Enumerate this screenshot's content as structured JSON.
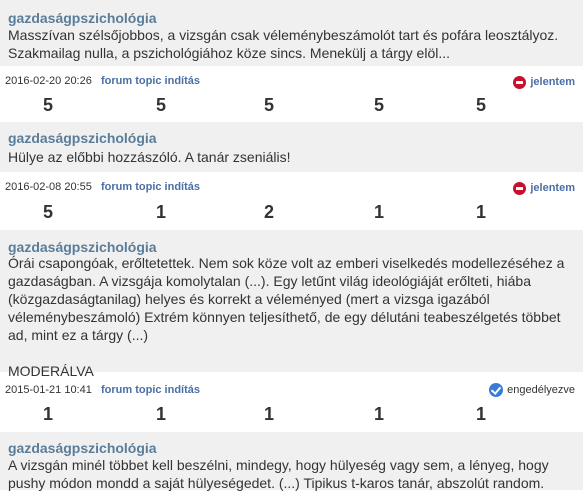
{
  "reviews": [
    {
      "subject": "gazdaságpszichológia",
      "text": "Masszívan szélsőjobbos, a vizsgán csak véleménybeszámolót tart és pofára leosztályoz. Szakmailag nulla, a pszichológiához köze sincs. Menekülj a tárgy elöl...",
      "date": "2016-02-20 20:26",
      "link": "forum topic indítás",
      "status": "jelentem",
      "status_icon": "stop-icon",
      "ratings": [
        "5",
        "5",
        "5",
        "5",
        "5"
      ]
    },
    {
      "subject": "gazdaságpszichológia",
      "text": "Hülye az előbbi hozzászóló. A tanár zseniális!",
      "date": "2016-02-08 20:55",
      "link": "forum topic indítás",
      "status": "jelentem",
      "status_icon": "stop-icon",
      "ratings": [
        "5",
        "1",
        "2",
        "1",
        "1"
      ]
    },
    {
      "subject": "gazdaságpszichológia",
      "text": "Órái csapongóak, erőltetettek. Nem sok köze volt az emberi viselkedés modellezéséhez a gazdaságban. A vizsgája komolytalan (...). Egy letűnt világ ideológiáját erőlteti, hiába (közgazdaságtanilag) helyes és korrekt a véleményed (mert a vizsga igazából véleménybeszámoló) Extrém könnyen teljesíthető, de egy délutáni teabeszélgetés többet ad, mint ez a tárgy (...)\n\nMODERÁLVA",
      "date": "2015-01-21 10:41",
      "link": "forum topic indítás",
      "status": "engedélyezve",
      "status_icon": "check-icon",
      "ratings": [
        "1",
        "1",
        "1",
        "1",
        "1"
      ]
    },
    {
      "subject": "gazdaságpszichológia",
      "text": "A vizsgán minél többet kell beszélni, mindegy, hogy hülyeség vagy sem, a lényeg, hogy pushy módon mondd a saját hülyeségedet. (...) Tipikus t-karos tanár, abszolút random."
    }
  ],
  "colors": {
    "card_bg": "#f0f0f0",
    "subject": "#5a7d9a",
    "link": "#4a6fa5",
    "stop": "#c8102e",
    "check": "#3a7bd5"
  }
}
